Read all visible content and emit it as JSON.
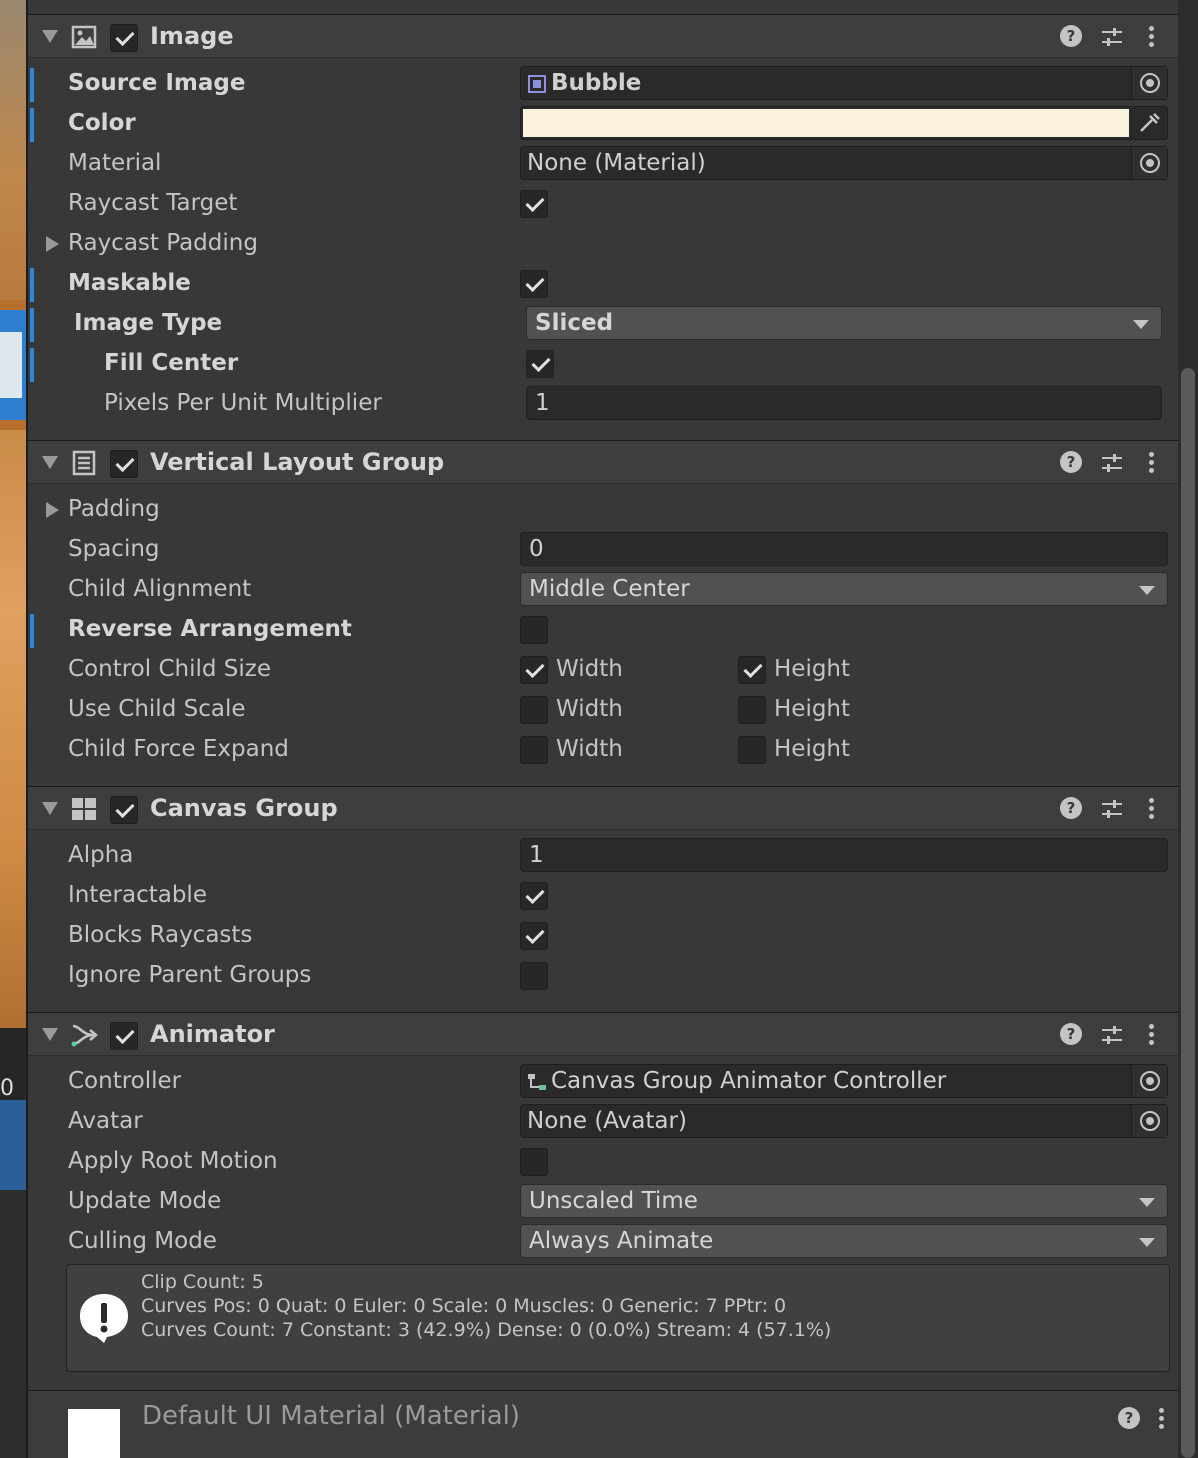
{
  "left_strip": {
    "text": "0"
  },
  "image": {
    "title": "Image",
    "enabled": true,
    "source_image": {
      "label": "Source Image",
      "value": "Bubble"
    },
    "color": {
      "label": "Color",
      "value": "#faf1de"
    },
    "material": {
      "label": "Material",
      "value": "None (Material)"
    },
    "raycast_target": {
      "label": "Raycast Target",
      "checked": true
    },
    "raycast_padding": {
      "label": "Raycast Padding"
    },
    "maskable": {
      "label": "Maskable",
      "checked": true
    },
    "image_type": {
      "label": "Image Type",
      "value": "Sliced"
    },
    "fill_center": {
      "label": "Fill Center",
      "checked": true
    },
    "ppu": {
      "label": "Pixels Per Unit Multiplier",
      "value": "1"
    }
  },
  "vlg": {
    "title": "Vertical Layout Group",
    "enabled": true,
    "padding": {
      "label": "Padding"
    },
    "spacing": {
      "label": "Spacing",
      "value": "0"
    },
    "child_alignment": {
      "label": "Child Alignment",
      "value": "Middle Center"
    },
    "reverse": {
      "label": "Reverse Arrangement",
      "checked": false
    },
    "width_label": "Width",
    "height_label": "Height",
    "control_child_size": {
      "label": "Control Child Size",
      "width": true,
      "height": true
    },
    "use_child_scale": {
      "label": "Use Child Scale",
      "width": false,
      "height": false
    },
    "child_force_expand": {
      "label": "Child Force Expand",
      "width": false,
      "height": false
    }
  },
  "canvas_group": {
    "title": "Canvas Group",
    "enabled": true,
    "alpha": {
      "label": "Alpha",
      "value": "1"
    },
    "interactable": {
      "label": "Interactable",
      "checked": true
    },
    "blocks_raycasts": {
      "label": "Blocks Raycasts",
      "checked": true
    },
    "ignore_parent": {
      "label": "Ignore Parent Groups",
      "checked": false
    }
  },
  "animator": {
    "title": "Animator",
    "enabled": true,
    "controller": {
      "label": "Controller",
      "value": "Canvas Group Animator Controller"
    },
    "avatar": {
      "label": "Avatar",
      "value": "None (Avatar)"
    },
    "apply_root_motion": {
      "label": "Apply Root Motion",
      "checked": false
    },
    "update_mode": {
      "label": "Update Mode",
      "value": "Unscaled Time"
    },
    "culling_mode": {
      "label": "Culling Mode",
      "value": "Always Animate"
    },
    "info": [
      "Clip Count: 5",
      "Curves Pos: 0 Quat: 0 Euler: 0 Scale: 0 Muscles: 0 Generic: 7 PPtr: 0",
      "Curves Count: 7 Constant: 3 (42.9%) Dense: 0 (0.0%) Stream: 4 (57.1%)"
    ]
  },
  "material_section": {
    "title": "Default UI Material (Material)"
  },
  "icons": {
    "help": "?"
  }
}
